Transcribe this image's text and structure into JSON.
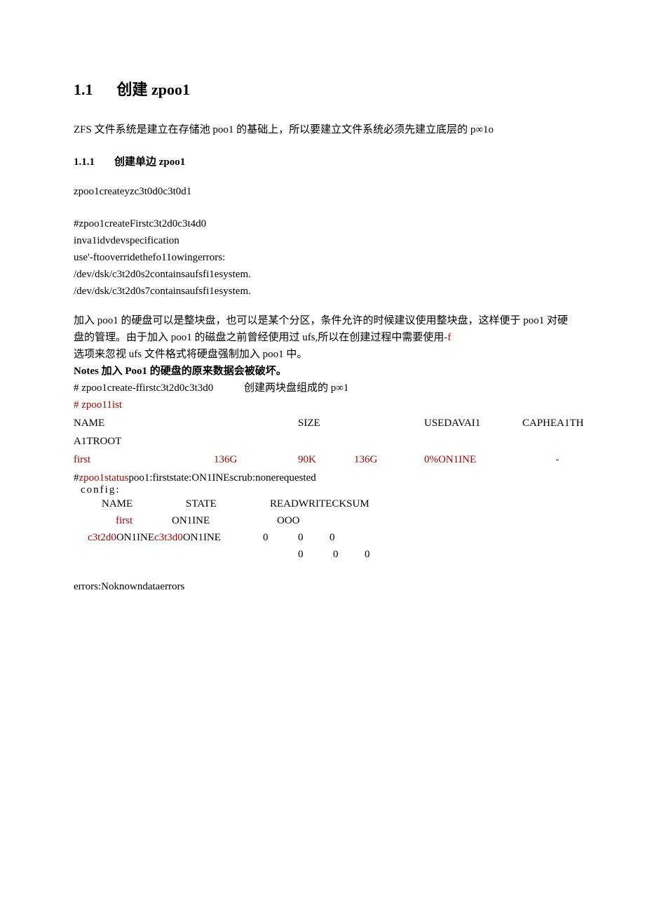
{
  "h1": {
    "num": "1.1",
    "title": "创建 zpoo1"
  },
  "intro": "ZFS 文件系统是建立在存储池 poo1 的基础上，所以要建立文件系统必须先建立底层的 p∞1o",
  "h2": {
    "num": "1.1.1",
    "title": "创建单边 zpoo1"
  },
  "cmd1": "zpoo1createyzc3t0d0c3t0d1",
  "err": {
    "l1": "#zpoo1createFirstc3t2d0c3t4d0",
    "l2": "inva1idvdevspecification",
    "l3": "use'-ftooverridethefo11owingerrors:",
    "l4": "/dev/dsk/c3t2d0s2containsaufsfi1esystem.",
    "l5": "/dev/dsk/c3t2d0s7containsaufsfi1esystem."
  },
  "explain": {
    "p1a": "加入 poo1 的硬盘可以是整块盘，也可以是某个分区，条件允许的时候建议使用整块盘，这样便于 poo1 对硬盘的管理。由于加入 poo1 的磁盘之前曾经使用过 ufs,所以在创建过程中需要使用",
    "dashf": "-f",
    "p1b": "选项来忽视 ufs 文件格式将硬盘强制加入 poo1 中。",
    "note": "Notes 加入 Poo1 的硬盘的原来数据会被破坏。"
  },
  "cmd2": {
    "a": "# zpoo1create-ffirstc3t2d0c3t3d0",
    "b": "创建两块盘组成的 p∞1"
  },
  "cmd3": "# zpoo11ist",
  "listhdr": {
    "c1": "NAME",
    "c2": "",
    "c3": "SIZE",
    "c4": "",
    "c5": "USEDAVAI1",
    "c6": "CAPHEA1TH"
  },
  "altroot": "A1TROOT",
  "listrow": {
    "c1": "first",
    "c2": "136G",
    "c3": "90K",
    "c4": "136G",
    "c5": "0%ON1INE",
    "c6": "-"
  },
  "status": {
    "prefix": "#",
    "cmd": "zpoo1status",
    "rest": "poo1:firststate:ON1INEscrub:nonerequested",
    "config": "config:",
    "hdr": {
      "c1": "NAME",
      "c2": "STATE",
      "c3": "READWRITECKSUM"
    },
    "r1": {
      "c1": "first",
      "c2": "ON1INE",
      "c3": "OOO"
    },
    "r2a": "c3t2d0",
    "r2b": "ON1INE",
    "r2c": "c3t3d0",
    "r2d": "ON1INE",
    "z": "0"
  },
  "errors": "errors:Noknowndataerrors"
}
